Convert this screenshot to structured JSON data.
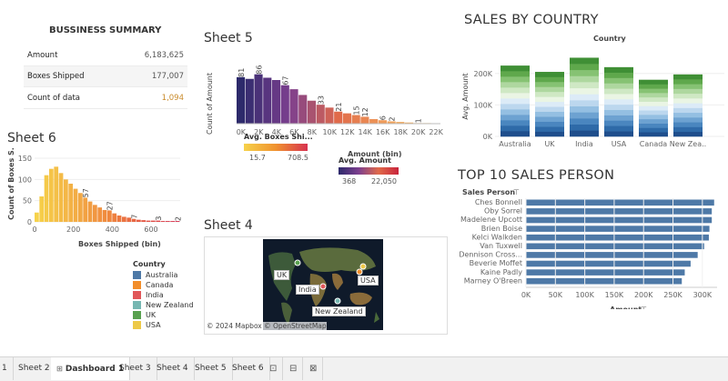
{
  "summary": {
    "title": "BUSSINESS SUMMARY",
    "rows": [
      {
        "label": "Amount",
        "value": "6,183,625"
      },
      {
        "label": "Boxes Shipped",
        "value": "177,007"
      },
      {
        "label": "Count of data",
        "value": "1,094"
      }
    ]
  },
  "sheet5": {
    "title": "Sheet 5",
    "ylabel": "Count of Amount",
    "xlabel": "Amount (bin)",
    "legend_title": "Avg. Boxes Shi...",
    "legend_min": "15.7",
    "legend_max": "708.5"
  },
  "sheet6": {
    "title": "Sheet 6",
    "ylabel": "Count of Boxes S.",
    "xlabel": "Boxes Shipped (bin)",
    "legend_title": "Avg. Amount",
    "legend_min": "368",
    "legend_max": "22,050"
  },
  "sheet4": {
    "title": "Sheet 4",
    "map_credit": "© 2024 Mapbox © OpenStreetMap",
    "markers": [
      "UK",
      "India",
      "USA",
      "New Zealand"
    ]
  },
  "country_legend": {
    "title": "Country",
    "items": [
      {
        "label": "Australia",
        "color": "#4e79a7"
      },
      {
        "label": "Canada",
        "color": "#f28e2b"
      },
      {
        "label": "India",
        "color": "#e15759"
      },
      {
        "label": "New Zealand",
        "color": "#76b7b2"
      },
      {
        "label": "UK",
        "color": "#59a14f"
      },
      {
        "label": "USA",
        "color": "#edc948"
      }
    ]
  },
  "sales_country": {
    "title": "SALES BY COUNTRY",
    "header": "Country",
    "ylabel": "Avg. Amount"
  },
  "top10": {
    "title": "TOP 10 SALES PERSON",
    "header": "Sales Person",
    "xlabel": "Amount"
  },
  "tabs": [
    "1",
    "Sheet 2",
    "Dashboard 1",
    "Sheet 3",
    "Sheet 4",
    "Sheet 5",
    "Sheet 6"
  ],
  "chart_data": [
    {
      "type": "bar",
      "name": "Sheet 5",
      "categories": [
        "0K",
        "1K",
        "2K",
        "3K",
        "4K",
        "5K",
        "6K",
        "7K",
        "8K",
        "9K",
        "10K",
        "11K",
        "12K",
        "13K",
        "14K",
        "15K",
        "16K",
        "17K",
        "18K",
        "19K",
        "20K",
        "21K",
        "22K"
      ],
      "tick_labels": [
        "0K",
        "2K",
        "4K",
        "6K",
        "8K",
        "10K",
        "12K",
        "14K",
        "16K",
        "18K",
        "20K",
        "22K"
      ],
      "values": [
        81,
        78,
        86,
        80,
        76,
        67,
        60,
        50,
        40,
        33,
        28,
        21,
        18,
        15,
        12,
        8,
        6,
        4,
        3,
        2,
        1,
        1,
        0
      ],
      "data_labels": {
        "0": "81",
        "2": "86",
        "5": "67",
        "9": "33",
        "11": "21",
        "13": "15",
        "14": "12",
        "16": "6",
        "17": "2",
        "20": "1"
      },
      "ylim": [
        0,
        95
      ]
    },
    {
      "type": "bar",
      "name": "Sheet 6",
      "categories": [
        "0",
        "25",
        "50",
        "75",
        "100",
        "125",
        "150",
        "175",
        "200",
        "225",
        "250",
        "275",
        "300",
        "325",
        "350",
        "375",
        "400",
        "425",
        "450",
        "475",
        "500",
        "525",
        "550",
        "575",
        "600",
        "625",
        "650",
        "675",
        "700",
        "725"
      ],
      "tick_labels": [
        "0",
        "200",
        "400",
        "600"
      ],
      "values": [
        22,
        60,
        110,
        125,
        130,
        115,
        100,
        90,
        78,
        68,
        57,
        48,
        40,
        34,
        28,
        27,
        20,
        15,
        12,
        10,
        7,
        5,
        4,
        3,
        3,
        3,
        2,
        2,
        2,
        2
      ],
      "data_labels": {
        "10": "57",
        "15": "27",
        "20": "7",
        "25": "3",
        "29": "2"
      },
      "yticks": [
        0,
        50,
        100,
        150
      ],
      "ylim": [
        0,
        150
      ]
    },
    {
      "type": "bar",
      "name": "SALES BY COUNTRY",
      "categories": [
        "Australia",
        "UK",
        "India",
        "USA",
        "Canada",
        "New Zea.."
      ],
      "values": [
        225000,
        205000,
        250000,
        220000,
        180000,
        197000
      ],
      "yticks": [
        "0K",
        "100K",
        "200K"
      ],
      "ylim": [
        0,
        260000
      ]
    },
    {
      "type": "bar",
      "name": "TOP 10 SALES PERSON",
      "orientation": "horizontal",
      "categories": [
        "Ches Bonnell",
        "Oby Sorrel",
        "Madelene Upcott",
        "Brien Boise",
        "Kelci Walkden",
        "Van Tuxwell",
        "Dennison Cross...",
        "Beverie Moffet",
        "Kaine Padly",
        "Marney O'Breen"
      ],
      "values": [
        320000,
        316000,
        316000,
        312000,
        311000,
        303000,
        292000,
        280000,
        270000,
        265000
      ],
      "xticks": [
        "0K",
        "50K",
        "100K",
        "150K",
        "200K",
        "250K",
        "300K"
      ],
      "xlim": [
        0,
        325000
      ]
    }
  ]
}
